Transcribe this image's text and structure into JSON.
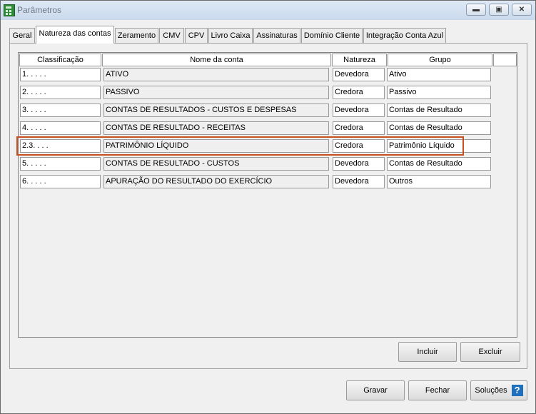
{
  "window": {
    "title": "Parâmetros"
  },
  "tabs": [
    {
      "label": "Geral"
    },
    {
      "label": "Natureza das contas",
      "active": true
    },
    {
      "label": "Zeramento"
    },
    {
      "label": "CMV"
    },
    {
      "label": "CPV"
    },
    {
      "label": "Livro Caixa"
    },
    {
      "label": "Assinaturas"
    },
    {
      "label": "Domínio Cliente"
    },
    {
      "label": "Integração Conta Azul"
    }
  ],
  "table": {
    "columns": [
      "Classificação",
      "Nome da conta",
      "Natureza",
      "Grupo"
    ],
    "rows": [
      {
        "classificacao": "1. . . . .",
        "nome": "ATIVO",
        "natureza": "Devedora",
        "grupo": "Ativo"
      },
      {
        "classificacao": "2. . . . .",
        "nome": "PASSIVO",
        "natureza": "Credora",
        "grupo": "Passivo"
      },
      {
        "classificacao": "3. . . . .",
        "nome": "CONTAS DE RESULTADOS - CUSTOS E DESPESAS",
        "natureza": "Devedora",
        "grupo": "Contas de Resultado"
      },
      {
        "classificacao": "4. . . . .",
        "nome": "CONTAS DE RESULTADO - RECEITAS",
        "natureza": "Credora",
        "grupo": "Contas de Resultado"
      },
      {
        "classificacao": "2.3. . . .",
        "nome": "PATRIMÔNIO LÍQUIDO",
        "natureza": "Credora",
        "grupo": "Patrimônio Líquido",
        "highlighted": true
      },
      {
        "classificacao": "5. . . . .",
        "nome": "CONTAS DE RESULTADO - CUSTOS",
        "natureza": "Devedora",
        "grupo": "Contas de Resultado"
      },
      {
        "classificacao": "6. . . . .",
        "nome": "APURAÇÃO DO RESULTADO DO EXERCÍCIO",
        "natureza": "Devedora",
        "grupo": "Outros"
      }
    ]
  },
  "panel_buttons": {
    "incluir": "Incluir",
    "excluir": "Excluir"
  },
  "footer_buttons": {
    "gravar": "Gravar",
    "fechar": "Fechar",
    "solucoes": "Soluções",
    "help_glyph": "?"
  },
  "colors": {
    "highlight": "#c6511f",
    "help_icon": "#1f6fbf",
    "app_icon": "#2e8b3a"
  }
}
